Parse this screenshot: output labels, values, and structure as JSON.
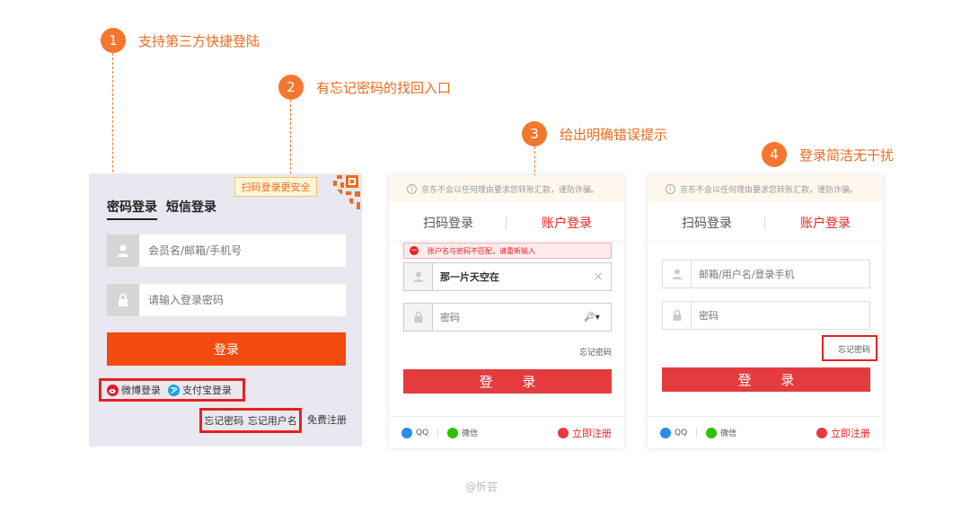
{
  "annotations": [
    {
      "num": "1",
      "text": "支持第三方快捷登陆"
    },
    {
      "num": "2",
      "text": "有忘记密码的找回入口"
    },
    {
      "num": "3",
      "text": "给出明确错误提示"
    },
    {
      "num": "4",
      "text": "登录简洁无干扰"
    }
  ],
  "panel1": {
    "tab_password": "密码登录",
    "tab_sms": "短信登录",
    "qr_badge": "扫码登录更安全",
    "username_placeholder": "会员名/邮箱/手机号",
    "password_placeholder": "请输入登录密码",
    "login_button": "登录",
    "weibo_login": "微博登录",
    "alipay_login": "支付宝登录",
    "forgot_password": "忘记密码",
    "forgot_username": "忘记用户名",
    "register": "免费注册"
  },
  "panel2": {
    "notice": "京东不会以任何理由要求您转账汇款，谨防诈骗。",
    "tab_scan": "扫码登录",
    "tab_account": "账户登录",
    "error": "账户名与密码不匹配，请重新输入",
    "username_value": "那一片天空在",
    "password_placeholder": "密码",
    "forgot_password": "忘记密码",
    "login_button": "登 录",
    "qq": "QQ",
    "wechat": "微信",
    "register": "立即注册"
  },
  "panel3": {
    "notice": "京东不会以任何理由要求您转账汇款，谨防诈骗。",
    "tab_scan": "扫码登录",
    "tab_account": "账户登录",
    "username_placeholder": "邮箱/用户名/登录手机",
    "password_placeholder": "密码",
    "forgot_password": "忘记密码",
    "login_button": "登 录",
    "qq": "QQ",
    "wechat": "微信",
    "register": "立即注册"
  },
  "watermark": "@忻芸",
  "colors": {
    "accent_orange": "#f5772f",
    "jd_red": "#e33b3e",
    "highlight_red": "#e4221d"
  }
}
